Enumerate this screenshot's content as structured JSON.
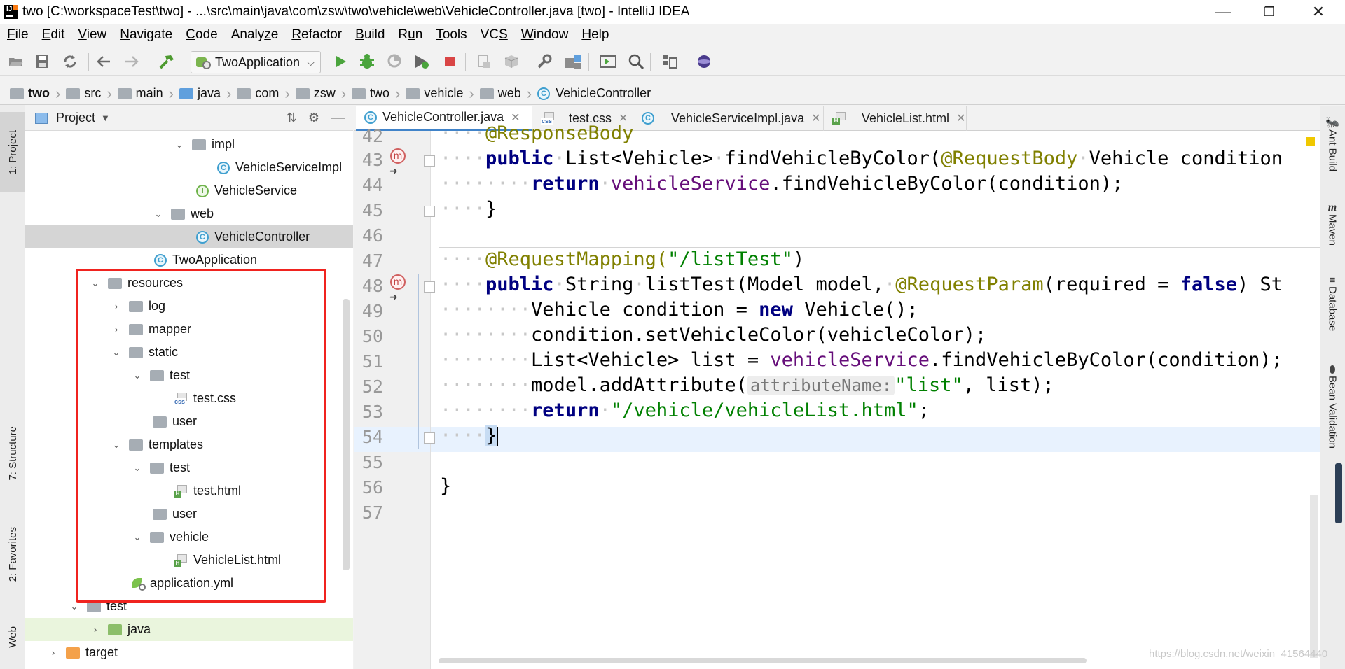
{
  "window": {
    "title": "two [C:\\workspaceTest\\two] - ...\\src\\main\\java\\com\\zsw\\two\\vehicle\\web\\VehicleController.java [two] - IntelliJ IDEA",
    "minimize": "—",
    "restore": "❐",
    "close": "✕"
  },
  "menu": [
    "File",
    "Edit",
    "View",
    "Navigate",
    "Code",
    "Analyze",
    "Refactor",
    "Build",
    "Run",
    "Tools",
    "VCS",
    "Window",
    "Help"
  ],
  "menu_mnemonics": [
    "F",
    "E",
    "V",
    "N",
    "C",
    "z",
    "R",
    "B",
    "u",
    "T",
    "S",
    "W",
    "H"
  ],
  "toolbar": {
    "run_config": "TwoApplication",
    "icons": [
      "open-folder-icon",
      "save-icon",
      "sync-icon",
      "back-icon",
      "forward-icon",
      "build-hammer-icon",
      "run-icon",
      "debug-icon",
      "coverage-icon",
      "profile-icon",
      "stop-icon",
      "wrench-icon",
      "project-structure-icon",
      "terminal-icon",
      "search-icon",
      "vcs-icon",
      "plugin-icon"
    ]
  },
  "breadcrumb": [
    "two",
    "src",
    "main",
    "java",
    "com",
    "zsw",
    "two",
    "vehicle",
    "web",
    "VehicleController"
  ],
  "left_stripe": {
    "project": "1: Project",
    "structure": "7: Structure",
    "favorites": "2: Favorites",
    "web": "Web"
  },
  "project_panel": {
    "title": "Project",
    "tree": [
      {
        "label": "impl",
        "type": "folder",
        "arrow": "⌄"
      },
      {
        "label": "VehicleServiceImpl",
        "type": "class"
      },
      {
        "label": "VehicleService",
        "type": "interface"
      },
      {
        "label": "web",
        "type": "folder",
        "arrow": "⌄"
      },
      {
        "label": "VehicleController",
        "type": "class"
      },
      {
        "label": "TwoApplication",
        "type": "class"
      },
      {
        "label": "resources",
        "type": "folder",
        "arrow": "⌄"
      },
      {
        "label": "log",
        "type": "folder",
        "arrow": "›"
      },
      {
        "label": "mapper",
        "type": "folder",
        "arrow": "›"
      },
      {
        "label": "static",
        "type": "folder",
        "arrow": "⌄"
      },
      {
        "label": "test",
        "type": "folder",
        "arrow": "⌄"
      },
      {
        "label": "test.css",
        "type": "css"
      },
      {
        "label": "user",
        "type": "folder"
      },
      {
        "label": "templates",
        "type": "folder",
        "arrow": "⌄"
      },
      {
        "label": "test",
        "type": "folder",
        "arrow": "⌄"
      },
      {
        "label": "test.html",
        "type": "html"
      },
      {
        "label": "user",
        "type": "folder"
      },
      {
        "label": "vehicle",
        "type": "folder",
        "arrow": "⌄"
      },
      {
        "label": "VehicleList.html",
        "type": "html"
      },
      {
        "label": "application.yml",
        "type": "yml"
      },
      {
        "label": "test",
        "type": "folder",
        "arrow": "⌄"
      },
      {
        "label": "java",
        "type": "folder-green",
        "arrow": "›"
      },
      {
        "label": "target",
        "type": "folder-orange",
        "arrow": "›"
      }
    ]
  },
  "tabs": [
    {
      "label": "VehicleController.java",
      "icon": "C",
      "active": true
    },
    {
      "label": "test.css",
      "icon": "css",
      "active": false
    },
    {
      "label": "VehicleServiceImpl.java",
      "icon": "C",
      "active": false
    },
    {
      "label": "VehicleList.html",
      "icon": "html",
      "active": false
    }
  ],
  "editor": {
    "line_numbers": [
      "42",
      "43",
      "44",
      "45",
      "46",
      "47",
      "48",
      "49",
      "50",
      "51",
      "52",
      "53",
      "54",
      "55",
      "56",
      "57"
    ],
    "partial_top": "@ResponseBody",
    "l43": {
      "kw": "public",
      "type": "List<Vehicle>",
      "name": "findVehicleByColor(",
      "ann": "@RequestBody",
      "rest": "Vehicle condition"
    },
    "l44": {
      "kw": "return",
      "fld": "vehicleService",
      "call": ".findVehicleByColor(",
      "par": "condition",
      "end": ");"
    },
    "l45": "}",
    "l47": {
      "ann": "@RequestMapping(",
      "str": "\"/listTest\"",
      "end": ")"
    },
    "l48": {
      "kw": "public",
      "type": "String",
      "name": "listTest(Model model,",
      "ann": "@RequestParam",
      "mid": "(required = ",
      "kw2": "false",
      "end": ") St"
    },
    "l49": {
      "type": "Vehicle condition = ",
      "kw": "new",
      "rest": " Vehicle();"
    },
    "l50": {
      "par": "condition",
      "call": ".setVehicleColor(",
      "par2": "vehicleColor",
      "end": ");"
    },
    "l51": {
      "type": "List<Vehicle> list = ",
      "fld": "vehicleService",
      "call": ".findVehicleByColor(",
      "par": "condition",
      "end": ");"
    },
    "l52": {
      "par": "model",
      "call": ".addAttribute(",
      "hint": "attributeName:",
      "str": "\"list\"",
      "end": ", list);"
    },
    "l53": {
      "kw": "return",
      "str": "\"/vehicle/vehicleList.html\"",
      "end": ";"
    },
    "l54": "}",
    "l56": "}",
    "gutter_marker": "m"
  },
  "right_stripe": [
    "Ant Build",
    "Maven",
    "Database",
    "Bean Validation"
  ],
  "watermark": "https://blog.csdn.net/weixin_41564440",
  "colors": {
    "highlight_box": "#f0231f",
    "active_tab_underline": "#4083c9",
    "keyword": "#000080",
    "annotation": "#808000",
    "string": "#008000",
    "field": "#660e7a"
  }
}
